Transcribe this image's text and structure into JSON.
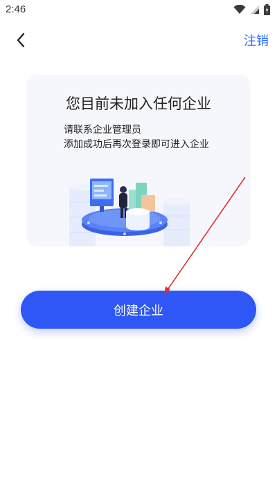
{
  "status_bar": {
    "time": "2:46",
    "icons": [
      "wifi-icon",
      "signal-icon",
      "battery-icon"
    ]
  },
  "nav": {
    "back_icon": "chevron-left-icon",
    "action_label": "注销"
  },
  "empty_state": {
    "title": "您目前未加入任何企业",
    "lines": [
      "请联系企业管理员",
      "添加成功后再次登录即可进入企业"
    ]
  },
  "primary_button": {
    "label": "创建企业"
  },
  "colors": {
    "accent": "#2f6bff",
    "button": "#2e57f5",
    "card_bg": "#f6f7fc",
    "annotation": "#e03131"
  }
}
